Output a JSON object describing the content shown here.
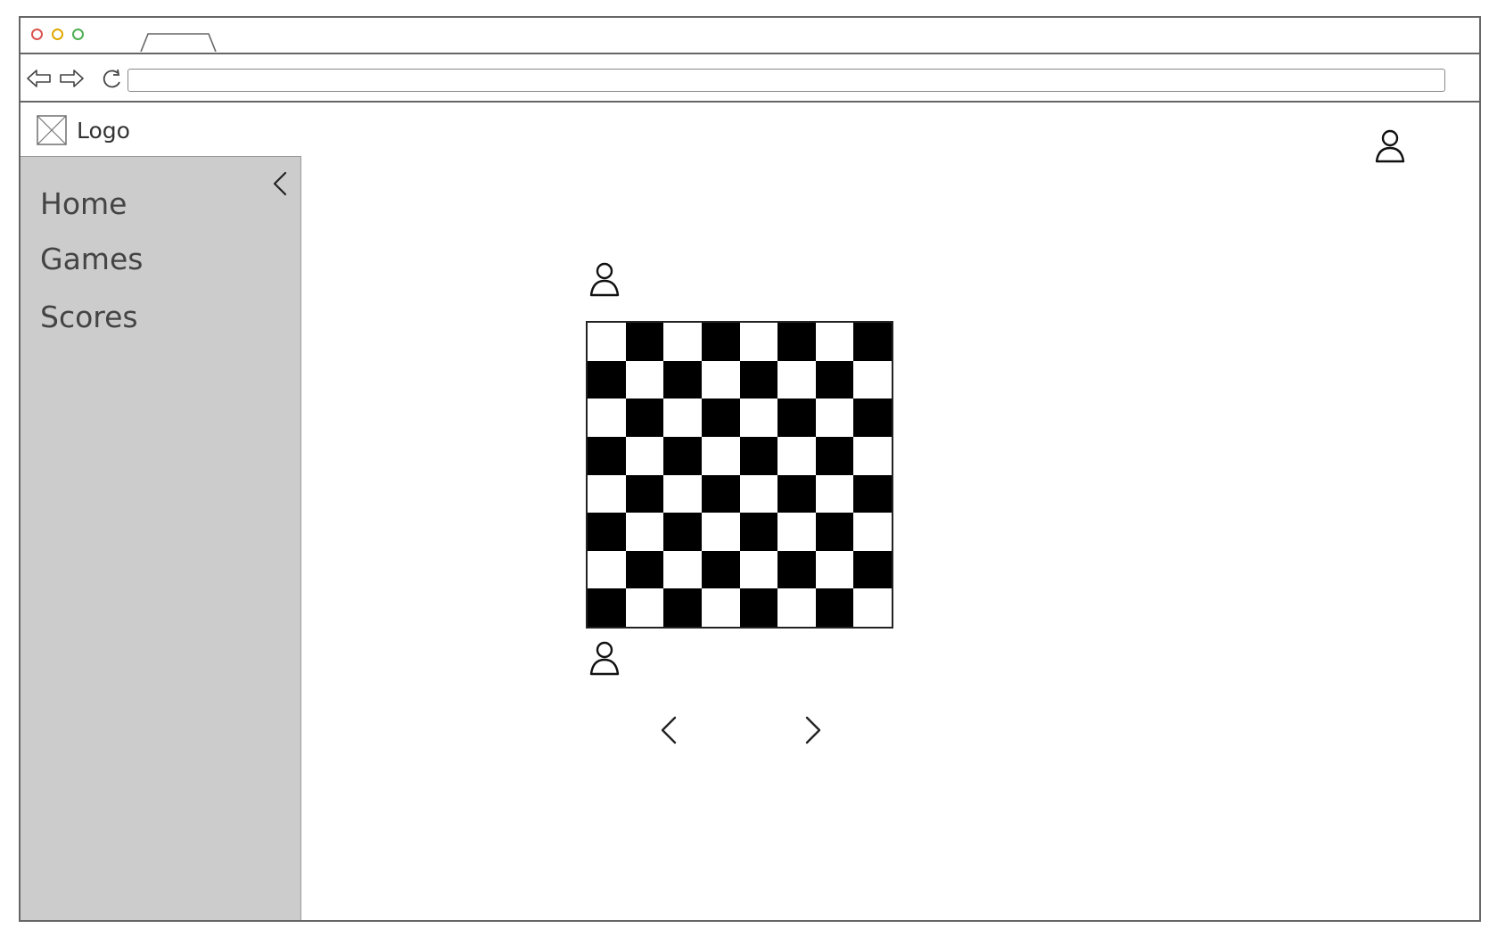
{
  "window": {
    "controls": [
      "close",
      "minimize",
      "maximize"
    ],
    "colors": {
      "close": "#d9534f",
      "minimize": "#e0a800",
      "maximize": "#4caf50"
    }
  },
  "toolbar": {
    "icons": [
      "back-arrow-icon",
      "forward-arrow-icon",
      "reload-icon"
    ],
    "url": ""
  },
  "header": {
    "logo_text": "Logo",
    "logo_icon": "image-placeholder-icon",
    "user_icon": "user-icon"
  },
  "sidebar": {
    "collapse_icon": "chevron-left-icon",
    "background": "#cccccc",
    "items": [
      {
        "label": "Home"
      },
      {
        "label": "Games"
      },
      {
        "label": "Scores"
      }
    ]
  },
  "game": {
    "board": {
      "rows": 8,
      "cols": 8,
      "top_left_square": "light",
      "colors": {
        "dark": "#000000",
        "light": "#ffffff"
      }
    },
    "players": [
      "user-icon",
      "user-icon"
    ],
    "navigation": {
      "previous_icon": "chevron-left-icon",
      "next_icon": "chevron-right-icon"
    }
  }
}
